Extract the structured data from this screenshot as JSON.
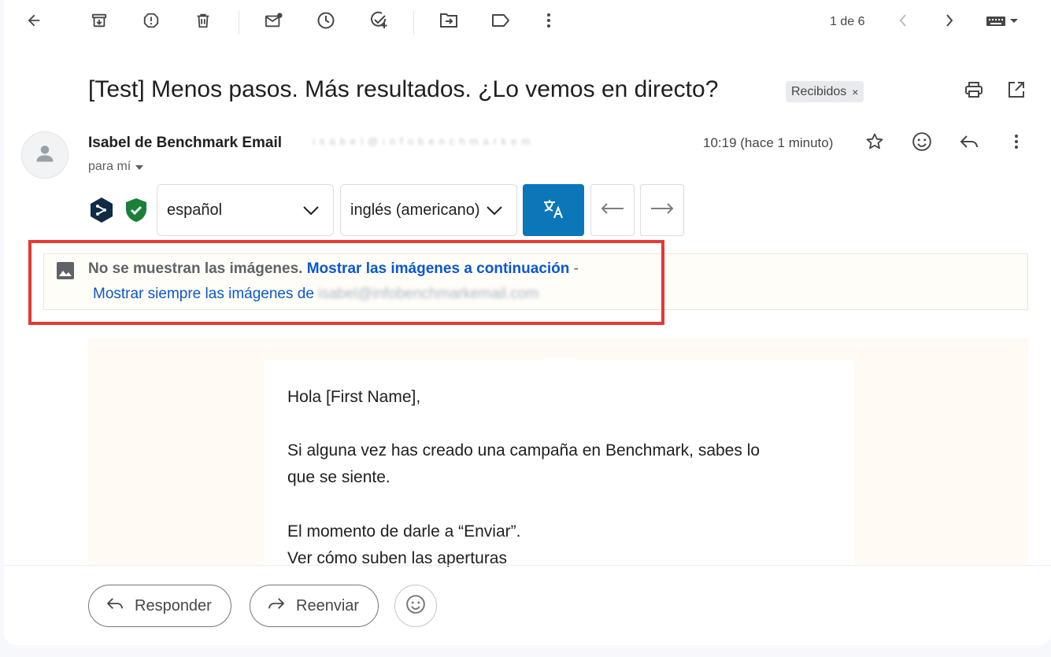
{
  "toolbar": {
    "back_icon": "arrow-left-icon",
    "archive_icon": "archive-icon",
    "report_spam_icon": "report-icon",
    "delete_icon": "trash-icon",
    "mark_unread_icon": "mail-dot-icon",
    "snooze_icon": "clock-icon",
    "add_task_icon": "add-task-icon",
    "move_to_icon": "folder-move-icon",
    "label_icon": "label-icon",
    "more_icon": "more-vert-icon",
    "pager": "1 de 6",
    "prev_icon": "chevron-left-icon",
    "next_icon": "chevron-right-icon",
    "input_tools_icon": "keyboard-icon"
  },
  "email": {
    "subject": "[Test] Menos pasos. Más resultados. ¿Lo vemos en directo?",
    "label_chip": "Recibidos",
    "label_chip_close": "×",
    "sender_name": "Isabel de Benchmark Email",
    "sender_email_redacted": "isabel@infobenchmarkemail.com",
    "recipient": "para mí",
    "time": "10:19 (hace 1 minuto)"
  },
  "translate": {
    "source_lang": "español",
    "target_lang": "inglés (americano)"
  },
  "images_notice": {
    "hidden_text": "No se muestran las imágenes.",
    "show_below_link": "Mostrar las imágenes a continuación",
    "dash": "-",
    "always_show_link_prefix": "Mostrar siempre las imágenes de",
    "always_show_link_email_redacted": "isabel@infobenchmarkemail.com"
  },
  "body": {
    "greeting": "Hola [First Name],",
    "p1_line1": "Si alguna vez has creado una campaña en Benchmark, sabes lo",
    "p1_line2": "que se siente.",
    "p2_line1": "El momento de darle a “Enviar”.",
    "p2_line2": "Ver cómo suben las aperturas"
  },
  "actions": {
    "reply": "Responder",
    "forward": "Reenviar"
  },
  "colors": {
    "translate_button": "#0b76b8",
    "link": "#0b57d0",
    "highlight_box": "#e53935",
    "body_background": "#fffaf4"
  }
}
